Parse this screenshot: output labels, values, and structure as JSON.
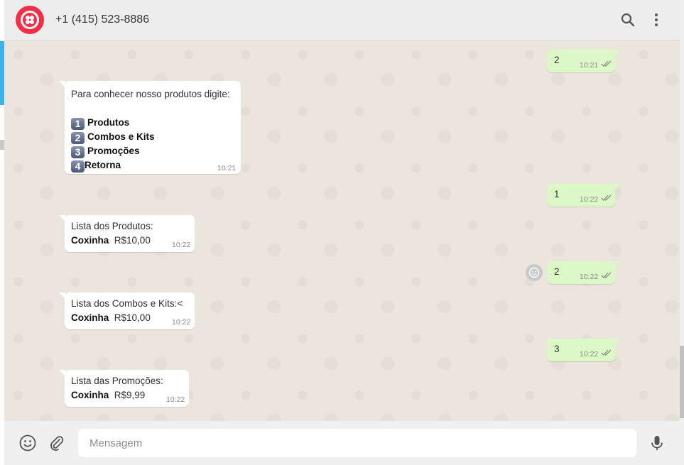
{
  "header": {
    "contact": "+1 (415) 523-8886",
    "avatar_icon": "twilio-logo-icon",
    "search_icon": "search-icon",
    "menu_icon": "more-vertical-icon"
  },
  "messages": [
    {
      "dir": "out",
      "text": "2",
      "time": "10:21",
      "status": "read"
    },
    {
      "dir": "in",
      "lines": [
        "Para conhecer nosso produtos digite:"
      ],
      "options": [
        {
          "key": "1",
          "label": "Produtos"
        },
        {
          "key": "2",
          "label": "Combos e Kits"
        },
        {
          "key": "3",
          "label": "Promoções"
        },
        {
          "key": "4",
          "label": "Retorna"
        }
      ],
      "time": "10:21"
    },
    {
      "dir": "out",
      "text": "1",
      "time": "10:22",
      "status": "read"
    },
    {
      "dir": "in",
      "title": "Lista dos Produtos:",
      "item": "Coxinha",
      "price": "R$10,00",
      "time": "10:22"
    },
    {
      "dir": "out",
      "text": "2",
      "time": "10:22",
      "status": "read",
      "reaction_icon": "smiley-icon"
    },
    {
      "dir": "in",
      "title": "Lista dos Combos e Kits:<",
      "item": "Coxinha",
      "price": "R$10,00",
      "time": "10:22"
    },
    {
      "dir": "out",
      "text": "3",
      "time": "10:22",
      "status": "read"
    },
    {
      "dir": "in",
      "title": "Lista das Promoções:",
      "item": "Coxinha",
      "price": "R$9,99",
      "time": "10:22"
    }
  ],
  "composer": {
    "placeholder": "Mensagem",
    "emoji_icon": "emoji-icon",
    "attach_icon": "paperclip-icon",
    "mic_icon": "microphone-icon"
  },
  "colors": {
    "brand": "#f22f46",
    "outgoing_bubble": "#dcf8c6",
    "incoming_bubble": "#ffffff",
    "chat_background": "#ece5dd",
    "read_ticks": "#8a8a8a"
  }
}
